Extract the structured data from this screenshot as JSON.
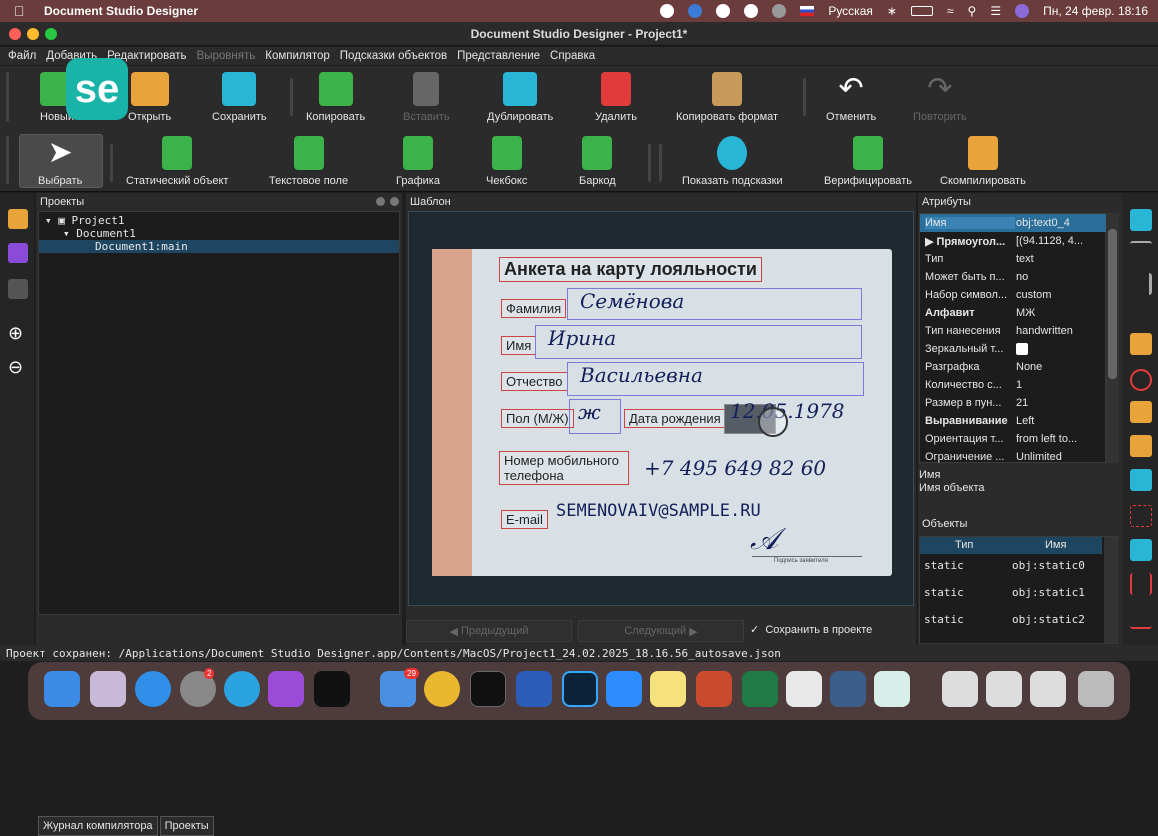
{
  "os_menubar": {
    "app_name": "Document Studio Designer",
    "input_language": "Русская",
    "datetime": "Пн, 24 февр.  18:16"
  },
  "window": {
    "title": "Document Studio Designer - Project1*"
  },
  "app_menu": [
    "Файл",
    "Добавить",
    "Редактировать",
    "Выровнять",
    "Компилятор",
    "Подсказки объектов",
    "Представление",
    "Справка"
  ],
  "toolbar1": {
    "new": "Новый",
    "open": "Открыть",
    "save": "Сохранить",
    "copy": "Копировать",
    "paste": "Вставить",
    "duplicate": "Дублировать",
    "delete": "Удалить",
    "copy_format": "Копировать формат",
    "undo": "Отменить",
    "redo": "Повторить",
    "logo_text": "se"
  },
  "toolbar2": {
    "select": "Выбрать",
    "static_object": "Статический объект",
    "text_field": "Текстовое поле",
    "graphic": "Графика",
    "checkbox": "Чекбокс",
    "barcode": "Баркод",
    "show_hints": "Показать подсказки",
    "verify": "Верифицировать",
    "compile": "Скомпилировать"
  },
  "projects_panel": {
    "title": "Проекты",
    "tree": [
      "Project1",
      "Document1",
      "Document1:main"
    ],
    "tabs": [
      "Журнал компилятора",
      "Проекты"
    ]
  },
  "template_panel": {
    "title": "Шаблон",
    "prev": "Предыдущий",
    "next": "Следующий",
    "save_in_project": "Сохранить в проекте"
  },
  "document": {
    "heading": "Анкета на карту лояльности",
    "labels": {
      "surname": "Фамилия",
      "name": "Имя",
      "patronymic": "Отчество",
      "sex": "Пол (М/Ж)",
      "birth": "Дата рождения",
      "phone": "Номер мобильного телефона",
      "email": "E-mail"
    },
    "values": {
      "surname": "Семёнова",
      "name": "Ирина",
      "patronymic": "Васильевна",
      "sex": "ж",
      "birth": "12.05.1978",
      "phone": "+7 495 649 82 60",
      "email": "SEMENOVAIV@SAMPLE.RU"
    },
    "signature_caption": "Подпись заявителя"
  },
  "attributes": {
    "title": "Атрибуты",
    "rows": [
      {
        "k": "Имя",
        "v": "obj:text0_4"
      },
      {
        "k": "▶ Прямоугол...",
        "v": "[(94.1128, 4..."
      },
      {
        "k": "Тип",
        "v": "text"
      },
      {
        "k": "Может быть п...",
        "v": "no"
      },
      {
        "k": "Набор символ...",
        "v": "custom"
      },
      {
        "k": "Алфавит",
        "v": "МЖ"
      },
      {
        "k": "Тип нанесения",
        "v": "handwritten"
      },
      {
        "k": "Зеркальный т...",
        "v": ""
      },
      {
        "k": "Разграфка",
        "v": "None"
      },
      {
        "k": "Количество с...",
        "v": "1"
      },
      {
        "k": "Размер в пун...",
        "v": "21"
      },
      {
        "k": "Выравнивание",
        "v": "Left"
      },
      {
        "k": "Ориентация т...",
        "v": "from left to..."
      },
      {
        "k": "Ограничение ...",
        "v": "Unlimited"
      }
    ],
    "desc_title": "Имя",
    "desc_text": "Имя объекта"
  },
  "objects": {
    "title": "Объекты",
    "headers": [
      "Тип",
      "Имя"
    ],
    "rows": [
      {
        "type": "static",
        "name": "obj:static0"
      },
      {
        "type": "static",
        "name": "obj:static1"
      },
      {
        "type": "static",
        "name": "obj:static2"
      }
    ]
  },
  "status_bar": "Проект сохранен: /Applications/Document Studio Designer.app/Contents/MacOS/Project1_24.02.2025_18.16.56_autosave.json",
  "dock": {
    "badge_settings": "2",
    "badge_mail": "29"
  },
  "colors": {
    "menubar": "#6b3c3c",
    "accent": "#2a6f9a",
    "label_box": "#cc4444",
    "field_box": "#7c7cd8"
  }
}
